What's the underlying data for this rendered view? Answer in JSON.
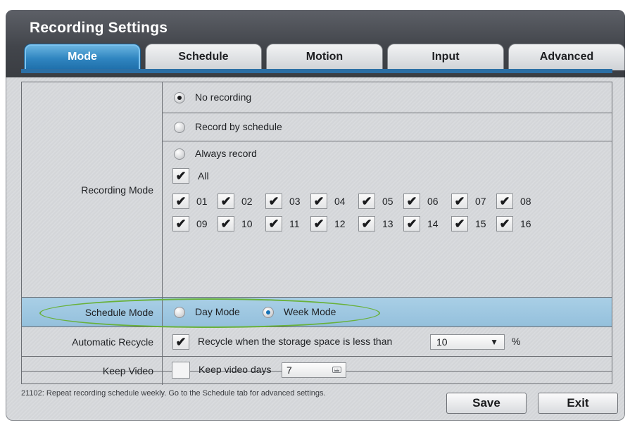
{
  "window": {
    "title": "Recording Settings"
  },
  "tabs": [
    {
      "label": "Mode",
      "active": true
    },
    {
      "label": "Schedule",
      "active": false
    },
    {
      "label": "Motion",
      "active": false
    },
    {
      "label": "Input",
      "active": false
    },
    {
      "label": "Advanced",
      "active": false
    }
  ],
  "recording_mode": {
    "label": "Recording Mode",
    "options": {
      "no_recording": "No recording",
      "by_schedule": "Record by schedule",
      "always": "Always record"
    },
    "selected": "no_recording",
    "all_label": "All",
    "all_checked": true,
    "channels": [
      "01",
      "02",
      "03",
      "04",
      "05",
      "06",
      "07",
      "08",
      "09",
      "10",
      "11",
      "12",
      "13",
      "14",
      "15",
      "16"
    ],
    "check_mark": "✔"
  },
  "schedule_mode": {
    "label": "Schedule Mode",
    "day_label": "Day Mode",
    "week_label": "Week Mode",
    "selected": "week"
  },
  "automatic_recycle": {
    "label": "Automatic Recycle",
    "checked": true,
    "text": "Recycle when the storage space is less than",
    "value": "10",
    "arrow": "▼",
    "unit": "%"
  },
  "keep_video": {
    "label": "Keep Video",
    "checked": false,
    "text": "Keep video days",
    "value": "7"
  },
  "footer": {
    "note": "21102: Repeat recording schedule weekly.  Go to the Schedule tab for advanced settings.",
    "save_label": "Save",
    "exit_label": "Exit"
  },
  "colors": {
    "active_tab": "#2f85c0",
    "highlight_row": "#a9cfe6",
    "annotation_ellipse": "#69b13a"
  }
}
